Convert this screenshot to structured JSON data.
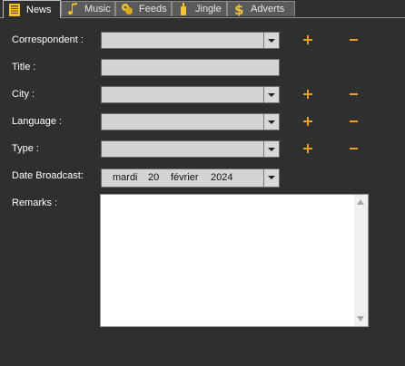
{
  "tabs": [
    {
      "label": "News",
      "icon": "newspaper-icon",
      "active": true
    },
    {
      "label": "Music",
      "icon": "music-note-icon",
      "active": false
    },
    {
      "label": "Feeds",
      "icon": "feeds-icon",
      "active": false
    },
    {
      "label": "Jingle",
      "icon": "jingle-icon",
      "active": false
    },
    {
      "label": "Adverts",
      "icon": "dollar-icon",
      "active": false
    }
  ],
  "form": {
    "correspondent_label": "Correspondent :",
    "correspondent_value": "",
    "title_label": "Title :",
    "title_value": "",
    "city_label": "City :",
    "city_value": "",
    "language_label": "Language :",
    "language_value": "",
    "type_label": "Type :",
    "type_value": "",
    "date_label": "Date Broadcast:",
    "date": {
      "weekday": "mardi",
      "day": "20",
      "month": "février",
      "year": "2024"
    },
    "remarks_label": "Remarks :",
    "remarks_value": ""
  },
  "colors": {
    "background": "#2f2f2f",
    "field": "#d4d4d4",
    "accent": "#f0a020"
  }
}
